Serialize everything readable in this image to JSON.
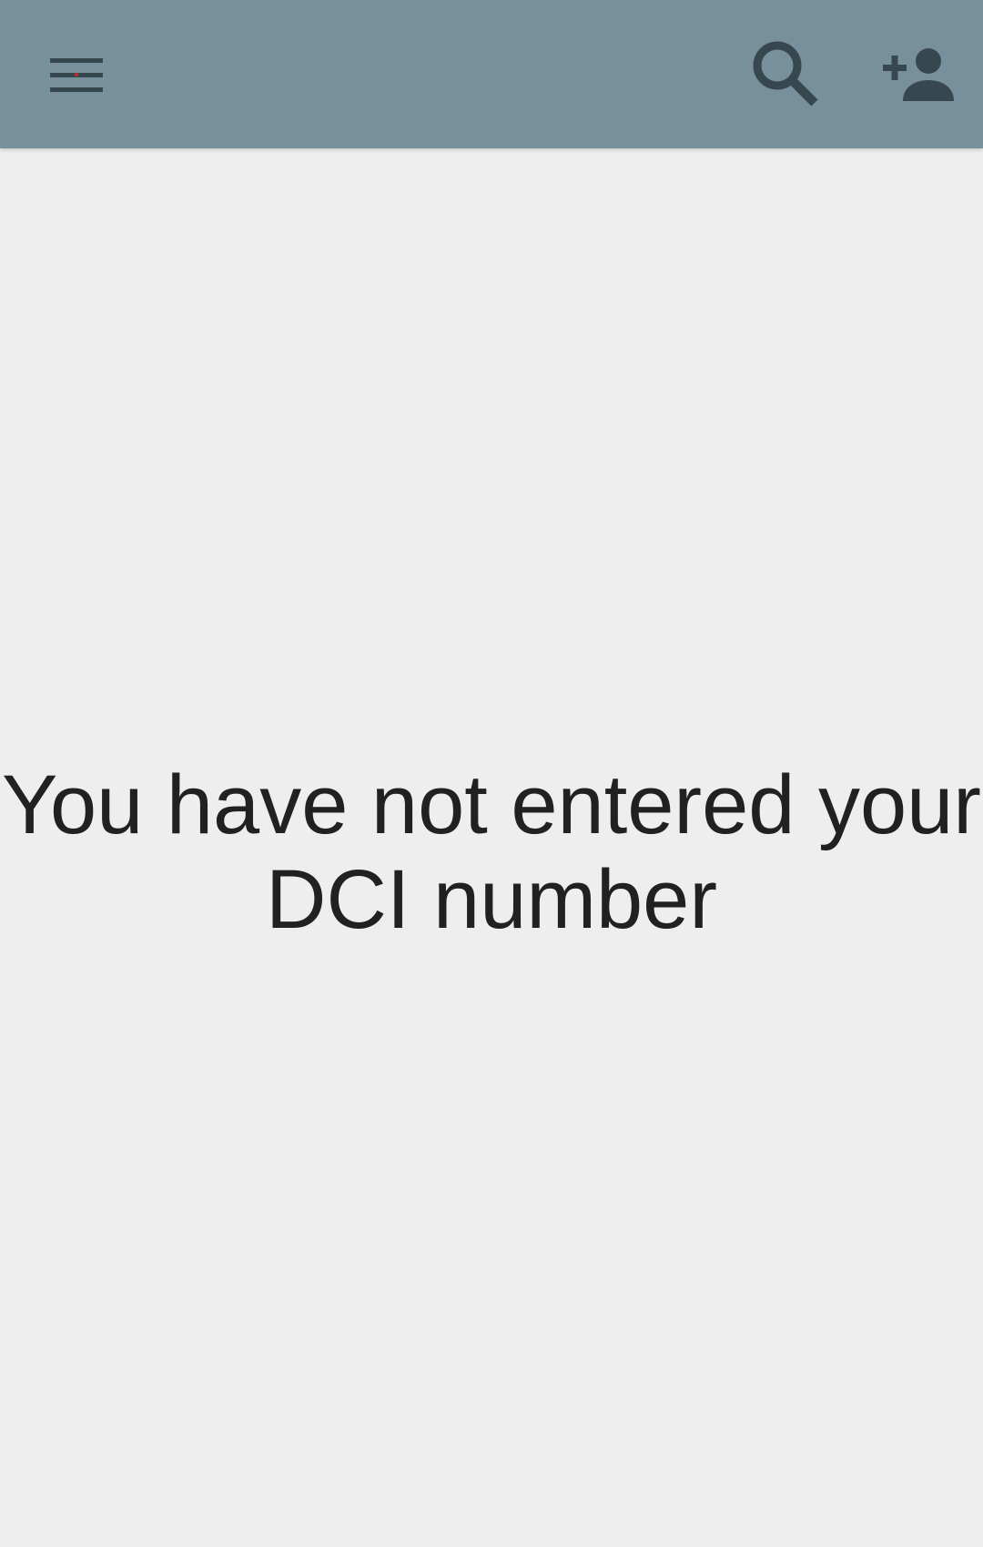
{
  "app_bar": {
    "background_color": "#78909c",
    "icon_color": "#37474f",
    "menu_icon": "hamburger-menu-icon",
    "search_icon": "search-icon",
    "add_user_icon": "person-add-icon"
  },
  "main": {
    "background_color": "#eeeeee",
    "message_line_1": "You have not entered your",
    "message_line_2": "DCI number"
  }
}
